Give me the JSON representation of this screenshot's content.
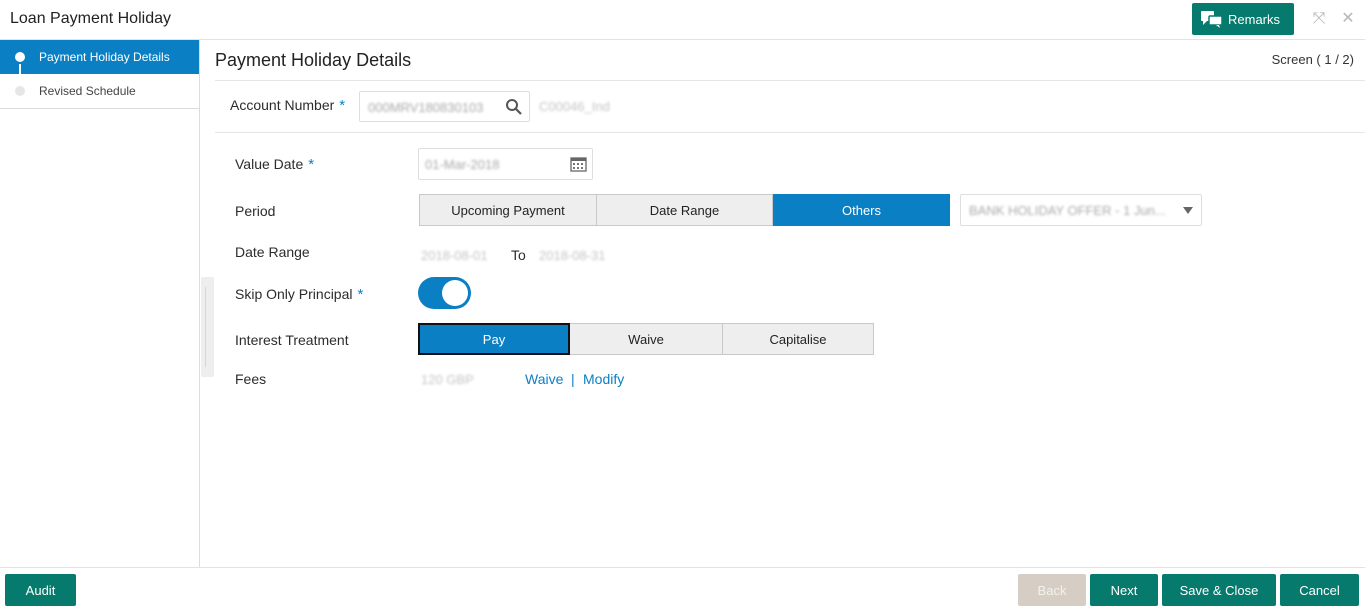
{
  "window": {
    "title": "Loan Payment Holiday",
    "remarks_label": "Remarks",
    "minimize_icon": "⤧",
    "close_icon": "✕"
  },
  "sidebar": {
    "items": [
      {
        "label": "Payment Holiday Details",
        "active": true
      },
      {
        "label": "Revised Schedule",
        "active": false
      }
    ]
  },
  "main": {
    "title": "Payment Holiday Details",
    "screen_indicator": "Screen ( 1 / 2)"
  },
  "account": {
    "label": "Account Number",
    "value": "000MRV180830103",
    "customer": "C00046_Ind"
  },
  "value_date": {
    "label": "Value Date",
    "value": "01-Mar-2018"
  },
  "period": {
    "label": "Period",
    "options": [
      "Upcoming Payment",
      "Date Range",
      "Others"
    ],
    "selected": "Others",
    "dropdown_value": "BANK HOLIDAY OFFER - 1 Jun..."
  },
  "date_range": {
    "label": "Date Range",
    "from": "2018-08-01",
    "to_label": "To",
    "to": "2018-08-31"
  },
  "skip_principal": {
    "label": "Skip Only Principal",
    "on": true
  },
  "interest_treatment": {
    "label": "Interest Treatment",
    "options": [
      "Pay",
      "Waive",
      "Capitalise"
    ],
    "selected": "Pay"
  },
  "fees": {
    "label": "Fees",
    "value": "120 GBP",
    "waive_label": "Waive",
    "separator": "|",
    "modify_label": "Modify"
  },
  "footer": {
    "audit": "Audit",
    "back": "Back",
    "next": "Next",
    "save_close": "Save & Close",
    "cancel": "Cancel"
  },
  "colors": {
    "primary_blue": "#0b7fc3",
    "teal": "#077a6e",
    "disabled": "#d6cec5"
  }
}
